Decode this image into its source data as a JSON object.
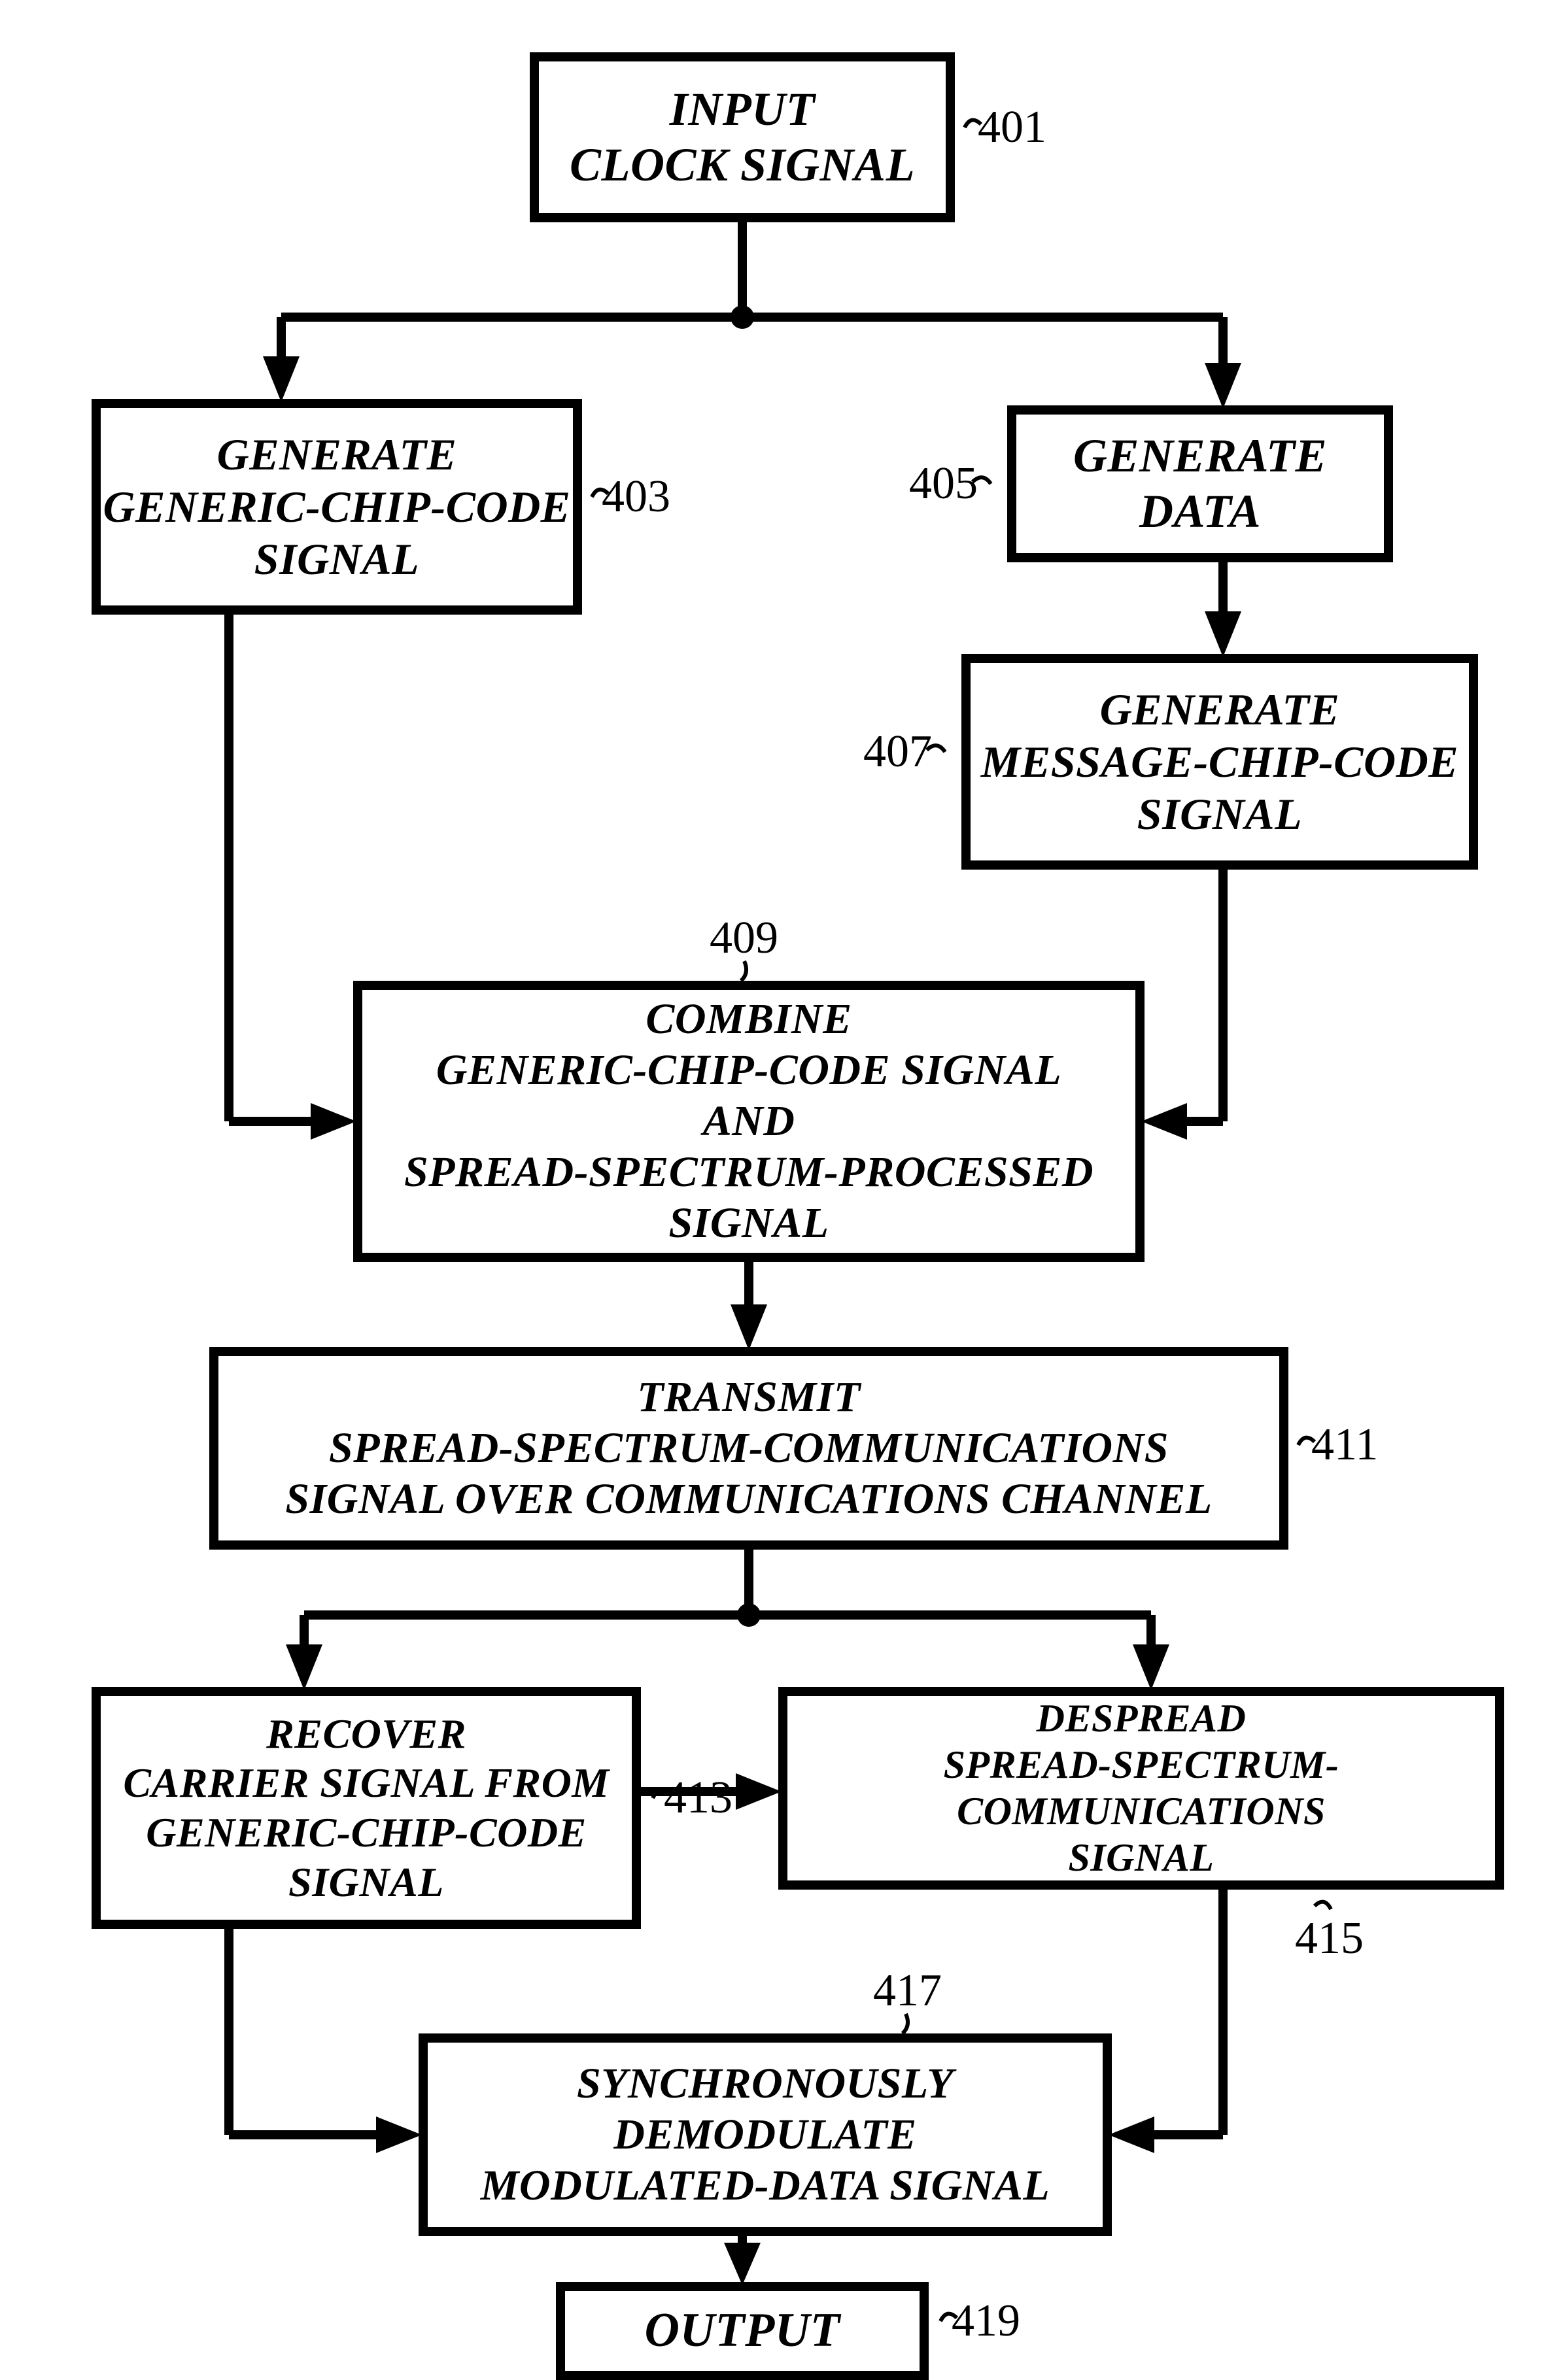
{
  "boxes": {
    "b401": "INPUT\nCLOCK SIGNAL",
    "b403": "GENERATE\nGENERIC-CHIP-CODE\nSIGNAL",
    "b405": "GENERATE\nDATA",
    "b407": "GENERATE\nMESSAGE-CHIP-CODE\nSIGNAL",
    "b409": "COMBINE\nGENERIC-CHIP-CODE SIGNAL\nAND\nSPREAD-SPECTRUM-PROCESSED\nSIGNAL",
    "b411": "TRANSMIT\nSPREAD-SPECTRUM-COMMUNICATIONS\nSIGNAL OVER COMMUNICATIONS CHANNEL",
    "b413": "RECOVER\nCARRIER SIGNAL FROM\nGENERIC-CHIP-CODE\nSIGNAL",
    "b415": "DESPREAD\nSPREAD-SPECTRUM-COMMUNICATIONS\nSIGNAL",
    "b417": "SYNCHRONOUSLY\nDEMODULATE\nMODULATED-DATA SIGNAL",
    "b419": "OUTPUT"
  },
  "labels": {
    "l401": "401",
    "l403": "403",
    "l405": "405",
    "l407": "407",
    "l409": "409",
    "l411": "411",
    "l413": "413",
    "l415": "415",
    "l417": "417",
    "l419": "419"
  }
}
